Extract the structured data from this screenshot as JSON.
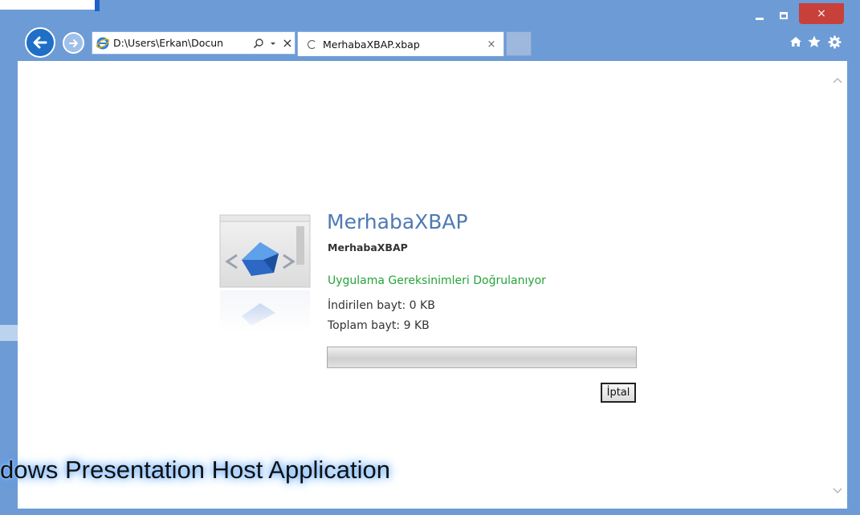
{
  "window": {
    "caption_buttons": {
      "minimize": "minimize",
      "maximize": "maximize",
      "close": "×"
    }
  },
  "toolbar": {
    "address": "D:\\Users\\Erkan\\Docun",
    "search_icon": "search-icon",
    "dropdown_icon": "chevron-down-icon",
    "stop_icon": "×",
    "tab_title": "MerhabaXBAP.xbap",
    "tab_close": "×",
    "tools": [
      "home-icon",
      "star-icon",
      "gear-icon"
    ]
  },
  "colors": {
    "frame": "#6d9bd6",
    "title_blue": "#4f7ab3",
    "status_green": "#26a33a",
    "close_red": "#c7403a"
  },
  "app": {
    "title": "MerhabaXBAP",
    "subtitle": "MerhabaXBAP",
    "status": "Uygulama Gereksinimleri Doğrulanıyor",
    "downloaded": "İndirilen bayt: 0 KB",
    "total": "Toplam bayt: 9 KB",
    "progress_fraction": 0,
    "cancel_label": "İptal"
  },
  "overlay": {
    "caption": "dows Presentation Host Application"
  }
}
